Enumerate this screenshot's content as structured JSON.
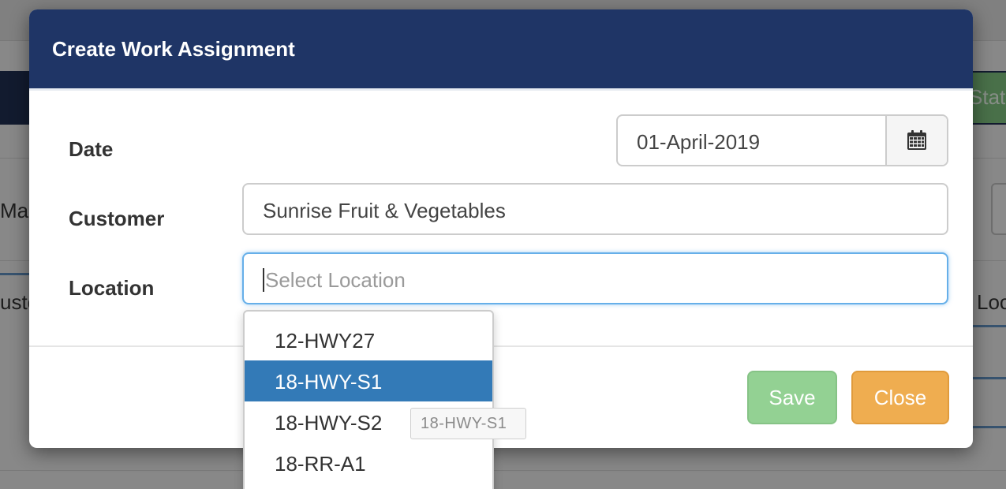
{
  "background": {
    "right_header_text": "Statu",
    "left_row1_text": "Mar",
    "left_row2_text": "usto",
    "right_row2_text": "Loc"
  },
  "modal": {
    "title": "Create Work Assignment",
    "fields": {
      "date": {
        "label": "Date",
        "value": "01-April-2019"
      },
      "customer": {
        "label": "Customer",
        "value": "Sunrise Fruit & Vegetables"
      },
      "location": {
        "label": "Location",
        "placeholder": "Select Location",
        "value": ""
      }
    },
    "buttons": {
      "save": "Save",
      "close": "Close"
    }
  },
  "location_dropdown": {
    "options": [
      "12-HWY27",
      "18-HWY-S1",
      "18-HWY-S2",
      "18-RR-A1"
    ],
    "highlighted": "18-HWY-S1",
    "tooltip": "18-HWY-S1"
  },
  "colors": {
    "header": "#1f3566",
    "highlight": "#337ab7",
    "save": "#93d193",
    "close": "#efad50"
  },
  "icons": {
    "date_addon": "calendar-icon"
  }
}
